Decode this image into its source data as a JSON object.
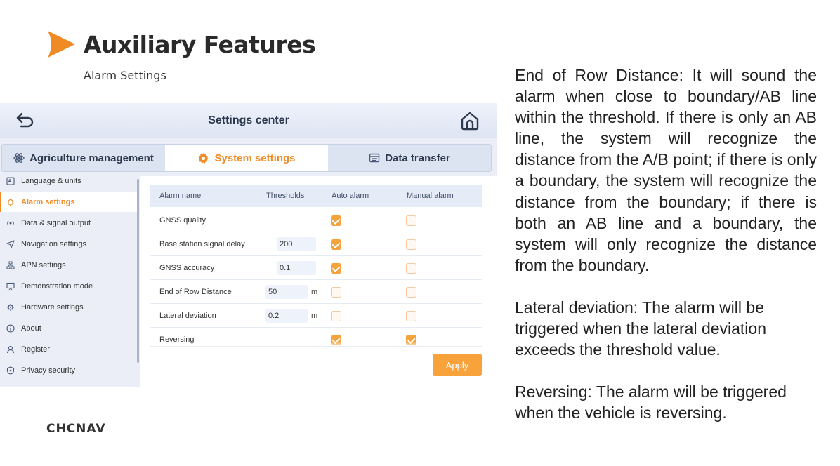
{
  "slide": {
    "title": "Auxiliary Features",
    "subtitle": "Alarm Settings",
    "logo": "CHCNAV",
    "description": [
      "End of Row Distance: It will sound the alarm when close to boundary/AB line within the threshold. If there is only an AB line, the system will recognize the distance from the A/B point; if there is only a boundary, the system will recognize the distance from the boundary; if there is both an AB line and a boundary, the system will only recognize the distance from the boundary.",
      "Lateral deviation: The alarm will be triggered when the lateral deviation exceeds the threshold value.",
      "Reversing: The alarm will be triggered when the vehicle is reversing."
    ]
  },
  "app": {
    "title": "Settings center",
    "tabs": [
      {
        "label": "Agriculture management",
        "icon": "atom-icon"
      },
      {
        "label": "System settings",
        "icon": "gear-icon",
        "active": true
      },
      {
        "label": "Data transfer",
        "icon": "data-transfer-icon"
      }
    ],
    "sidebar": [
      {
        "label": "Language & units",
        "icon": "language-icon"
      },
      {
        "label": "Alarm settings",
        "icon": "bell-icon",
        "active": true
      },
      {
        "label": "Data & signal output",
        "icon": "signal-icon"
      },
      {
        "label": "Navigation settings",
        "icon": "navigation-icon"
      },
      {
        "label": "APN settings",
        "icon": "network-icon"
      },
      {
        "label": "Demonstration mode",
        "icon": "presentation-icon"
      },
      {
        "label": "Hardware settings",
        "icon": "chip-icon"
      },
      {
        "label": "About",
        "icon": "info-icon"
      },
      {
        "label": "Register",
        "icon": "user-icon"
      },
      {
        "label": "Privacy security",
        "icon": "shield-icon"
      }
    ],
    "table": {
      "headers": [
        "Alarm name",
        "Thresholds",
        "Auto alarm",
        "Manual alarm"
      ],
      "rows": [
        {
          "name": "GNSS quality",
          "threshold": "",
          "unit": "",
          "auto": true,
          "manual": false
        },
        {
          "name": "Base station signal delay",
          "threshold": "200",
          "unit": "",
          "auto": true,
          "manual": false
        },
        {
          "name": "GNSS accuracy",
          "threshold": "0.1",
          "unit": "",
          "auto": true,
          "manual": false
        },
        {
          "name": "End of Row Distance",
          "threshold": "50",
          "unit": "m",
          "auto": false,
          "manual": false
        },
        {
          "name": "Lateral deviation",
          "threshold": "0.2",
          "unit": "m",
          "auto": false,
          "manual": false
        },
        {
          "name": "Reversing",
          "threshold": "",
          "unit": "",
          "auto": true,
          "manual": true
        }
      ]
    },
    "apply_label": "Apply",
    "colors": {
      "accent": "#f08a25",
      "checkbox_on": "#f5a33d"
    }
  }
}
